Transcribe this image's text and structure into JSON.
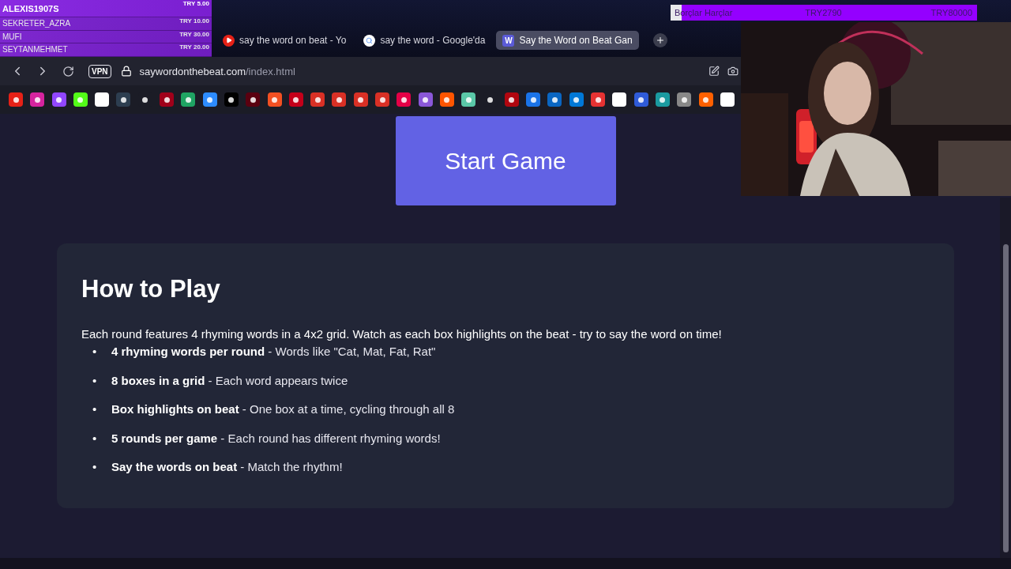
{
  "donations": [
    {
      "name": "ALEXIS1907S",
      "amount": "TRY 5.00",
      "top": true
    },
    {
      "name": "SEKRETER_AZRA",
      "amount": "TRY 10.00",
      "top": false
    },
    {
      "name": "MUFI",
      "amount": "TRY 30.00",
      "top": false
    },
    {
      "name": "SEYTANMEHMET",
      "amount": "TRY 20.00",
      "top": false
    }
  ],
  "goal": {
    "title": "Borçlar Harçlar",
    "raised": "TRY2790",
    "target": "TRY80000",
    "level": 0.035
  },
  "tabs": [
    {
      "title": "say the word on beat - Yo",
      "selected": false,
      "kind": "video"
    },
    {
      "title": "say the word - Google'da",
      "selected": false,
      "kind": "search"
    },
    {
      "title": "Say the Word on Beat Gan",
      "selected": true,
      "kind": "letter",
      "favicon": "W"
    }
  ],
  "address": {
    "vpn": "VPN",
    "domain": "saywordonthebeat.com",
    "path": "/index.html"
  },
  "start_button": "Start Game",
  "how_to_play": {
    "title": "How to Play",
    "intro": "Each round features 4 rhyming words in a 4x2 grid. Watch as each box highlights on the beat - try to say the word on time!",
    "rules": [
      {
        "marker": "•",
        "text": "**4 rhyming words per round** - Words like \"Cat, Mat, Fat, Rat\""
      },
      {
        "marker": "•",
        "text": "**8 boxes in a grid** - Each word appears twice"
      },
      {
        "marker": "•",
        "text": "**Box highlights on beat** - One box at a time, cycling through all 8"
      },
      {
        "marker": "•",
        "text": "**5 rounds per game** - Each round has different rhyming words!"
      },
      {
        "marker": "•",
        "text": "**Say the words on beat** - Match the rhythm!"
      }
    ]
  }
}
